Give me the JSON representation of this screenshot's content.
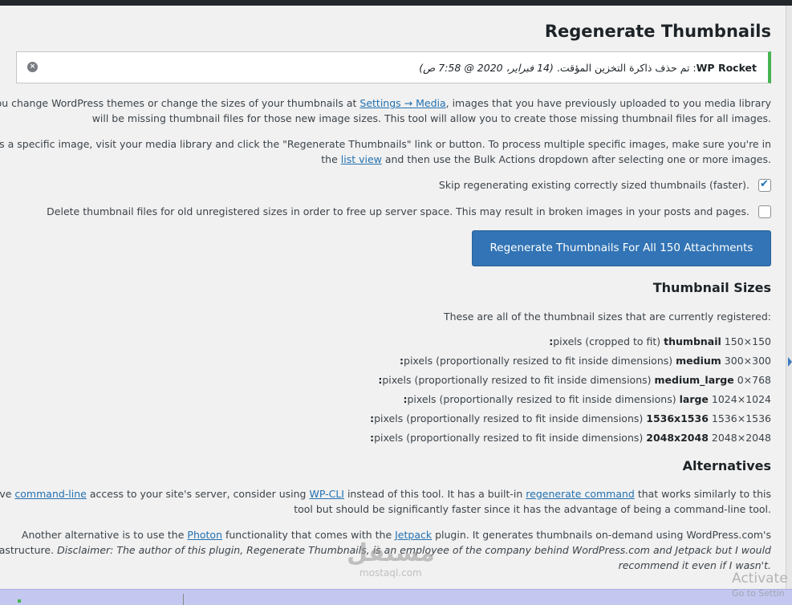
{
  "page": {
    "title": "Regenerate Thumbnails"
  },
  "notice": {
    "source": "WP Rocket",
    "message": ": تم حذف ذاكرة التخزين المؤقت.",
    "date": "(14 فبراير، 2020 @ 7:58 ص)",
    "dismiss_label": "×"
  },
  "intro": {
    "p1_line1_part1": "When you change WordPress themes or change the sizes of your thumbnails at ",
    "p1_link": "Settings → Media",
    "p1_line1_part2": ", images that you have previously uploaded to you media library",
    "p1_line2": ".will be missing thumbnail files for those new image sizes. This tool will allow you to create those missing thumbnail files for all images",
    "p2_line1": "To process a specific image, visit your media library and click the \"Regenerate Thumbnails\" link or button. To process multiple specific images, make sure you're in",
    "p2_line2_part1": ".the ",
    "p2_link": "list view",
    "p2_line2_part2": " and then use the Bulk Actions dropdown after selecting one or more images"
  },
  "options": {
    "skip_label": ".Skip regenerating existing correctly sized thumbnails (faster)",
    "skip_checked": true,
    "delete_label": ".Delete thumbnail files for old unregistered sizes in order to free up server space. This may result in broken images in your posts and pages",
    "delete_checked": false
  },
  "regenerate_button": "Regenerate Thumbnails For All 150 Attachments",
  "sizes": {
    "heading": "Thumbnail Sizes",
    "intro": ":These are all of the thumbnail sizes that are currently registered",
    "items": [
      {
        "name": "thumbnail:",
        "desc": "150×150 pixels (cropped to fit)"
      },
      {
        "name": "medium:",
        "desc": "300×300 pixels (proportionally resized to fit inside dimensions)"
      },
      {
        "name": "medium_large:",
        "desc": "768×0 pixels (proportionally resized to fit inside dimensions)"
      },
      {
        "name": "large:",
        "desc": "1024×1024 pixels (proportionally resized to fit inside dimensions)"
      },
      {
        "name": "1536x1536:",
        "desc": "1536×1536 pixels (proportionally resized to fit inside dimensions)"
      },
      {
        "name": "2048x2048:",
        "desc": "2048×2048 pixels (proportionally resized to fit inside dimensions)"
      }
    ]
  },
  "alternatives": {
    "heading": "Alternatives",
    "a1_part1": "If you have ",
    "a1_link1": "command-line",
    "a1_part2": " access to your site's server, consider using ",
    "a1_link2": "WP-CLI",
    "a1_part3": " instead of this tool. It has a built-in ",
    "a1_link3": "regenerate command",
    "a1_part4": " that works similarly to this",
    "a1_line2": ".tool but should be significantly faster since it has the advantage of being a command-line tool",
    "a2_part1": "Another alternative is to use the ",
    "a2_link1": "Photon",
    "a2_part2": " functionality that comes with the ",
    "a2_link2": "Jetpack",
    "a2_part3": " plugin. It generates thumbnails on-demand using WordPress.com's",
    "a2_line2_plain": "infrastructure. ",
    "a2_line2_italic": "Disclaimer: The author of this plugin, Regenerate Thumbnails, is an employee of the company behind WordPress.com and Jetpack but I would",
    "a2_line3_italic": ".recommend it even if I wasn't"
  },
  "watermark": {
    "arabic": "مستقل",
    "latin": "mostaql.com"
  },
  "windows": {
    "activate": "Activate",
    "goto_settings": "Go to Settin"
  }
}
